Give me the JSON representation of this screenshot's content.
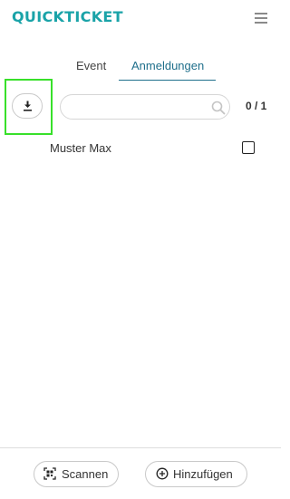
{
  "header": {
    "brand": "QUICKTICKET",
    "menu_icon": "hamburger-menu-icon"
  },
  "tabs": [
    {
      "label": "Event",
      "active": false
    },
    {
      "label": "Anmeldungen",
      "active": true
    }
  ],
  "toolbar": {
    "download_icon": "download-icon",
    "search": {
      "value": "",
      "placeholder": "",
      "icon": "search-icon"
    },
    "count": "0 / 1"
  },
  "list": {
    "items": [
      {
        "name": "Muster Max",
        "checked": false
      }
    ]
  },
  "footer": {
    "scan_label": "Scannen",
    "scan_icon": "qr-code-icon",
    "add_label": "Hinzufügen",
    "add_icon": "plus-circle-icon"
  },
  "colors": {
    "brand": "#1aa3a8",
    "active_tab": "#1f6f8b",
    "highlight": "#38e02a"
  }
}
